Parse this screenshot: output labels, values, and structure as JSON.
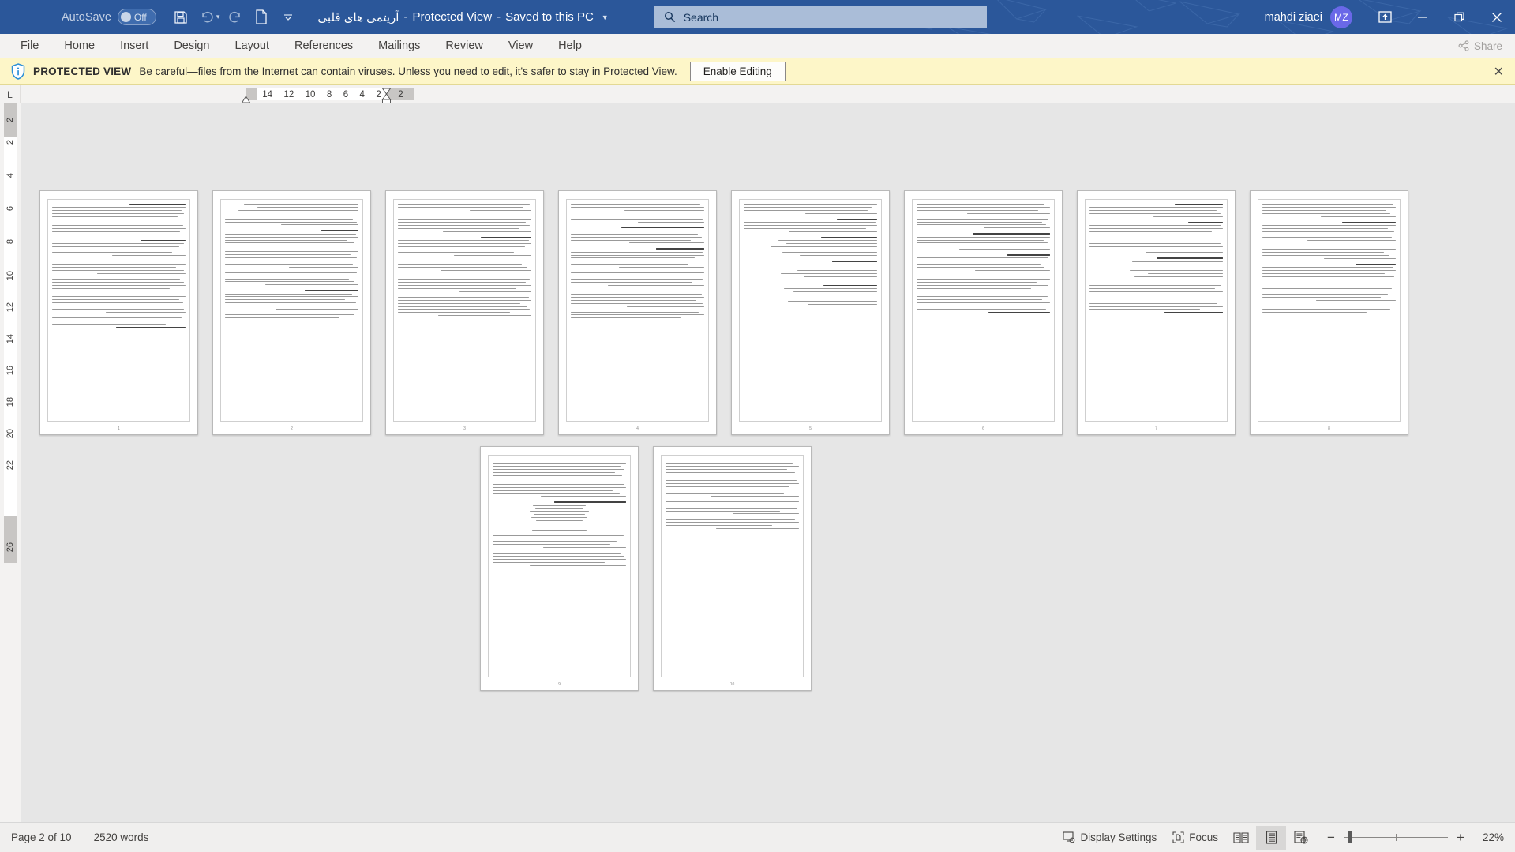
{
  "titlebar": {
    "autosave_label": "AutoSave",
    "autosave_state": "Off",
    "save_icon": "save-icon",
    "undo_icon": "undo-icon",
    "redo_icon": "redo-icon",
    "new_icon": "new-document-icon",
    "customize_qat_icon": "chevron-down-icon",
    "doc_name": "آریتمی های قلبی",
    "mode": "Protected View",
    "save_location": "Saved to this PC",
    "title_caret_icon": "chevron-down-icon",
    "search_placeholder": "Search",
    "search_icon": "search-icon",
    "account_name": "mahdi ziaei",
    "account_initials": "MZ",
    "ribbon_display_icon": "ribbon-display-options-icon",
    "minimize_icon": "minimize-icon",
    "restore_icon": "restore-icon",
    "close_icon": "close-icon",
    "accent_color": "#2b579a",
    "avatar_color": "#6a68e8"
  },
  "ribbon": {
    "tabs": [
      {
        "label": "File"
      },
      {
        "label": "Home"
      },
      {
        "label": "Insert"
      },
      {
        "label": "Design"
      },
      {
        "label": "Layout"
      },
      {
        "label": "References"
      },
      {
        "label": "Mailings"
      },
      {
        "label": "Review"
      },
      {
        "label": "View"
      },
      {
        "label": "Help"
      }
    ],
    "share_label": "Share",
    "share_icon": "share-icon"
  },
  "protected_view": {
    "shield_icon": "shield-info-icon",
    "title": "PROTECTED VIEW",
    "message": "Be careful—files from the Internet can contain viruses. Unless you need to edit, it's safer to stay in Protected View.",
    "enable_button": "Enable Editing",
    "close_icon": "close-icon",
    "background_color": "#fdf6c8"
  },
  "ruler": {
    "tabstop_marker": "L",
    "horizontal_numbers": [
      "14",
      "12",
      "10",
      "8",
      "6",
      "4",
      "2"
    ],
    "horizontal_right_number": "2",
    "vertical_top_number": "2",
    "vertical_numbers": [
      "2",
      "4",
      "6",
      "8",
      "10",
      "12",
      "14",
      "16",
      "18",
      "20",
      "22"
    ],
    "vertical_bottom_number": "26"
  },
  "document": {
    "page_count_visible": 10,
    "pages": [
      {
        "number": "1"
      },
      {
        "number": "2"
      },
      {
        "number": "3"
      },
      {
        "number": "4"
      },
      {
        "number": "5"
      },
      {
        "number": "6"
      },
      {
        "number": "7"
      },
      {
        "number": "8"
      },
      {
        "number": "9"
      },
      {
        "number": "10"
      }
    ]
  },
  "statusbar": {
    "page_info": "Page 2 of 10",
    "word_count": "2520 words",
    "display_settings_label": "Display Settings",
    "display_settings_icon": "display-settings-icon",
    "focus_label": "Focus",
    "focus_icon": "focus-icon",
    "view_read_icon": "read-mode-icon",
    "view_print_icon": "print-layout-icon",
    "view_web_icon": "web-layout-icon",
    "active_view": "print-layout",
    "zoom_out_icon": "minus-icon",
    "zoom_in_icon": "plus-icon",
    "zoom_level": "22%"
  }
}
